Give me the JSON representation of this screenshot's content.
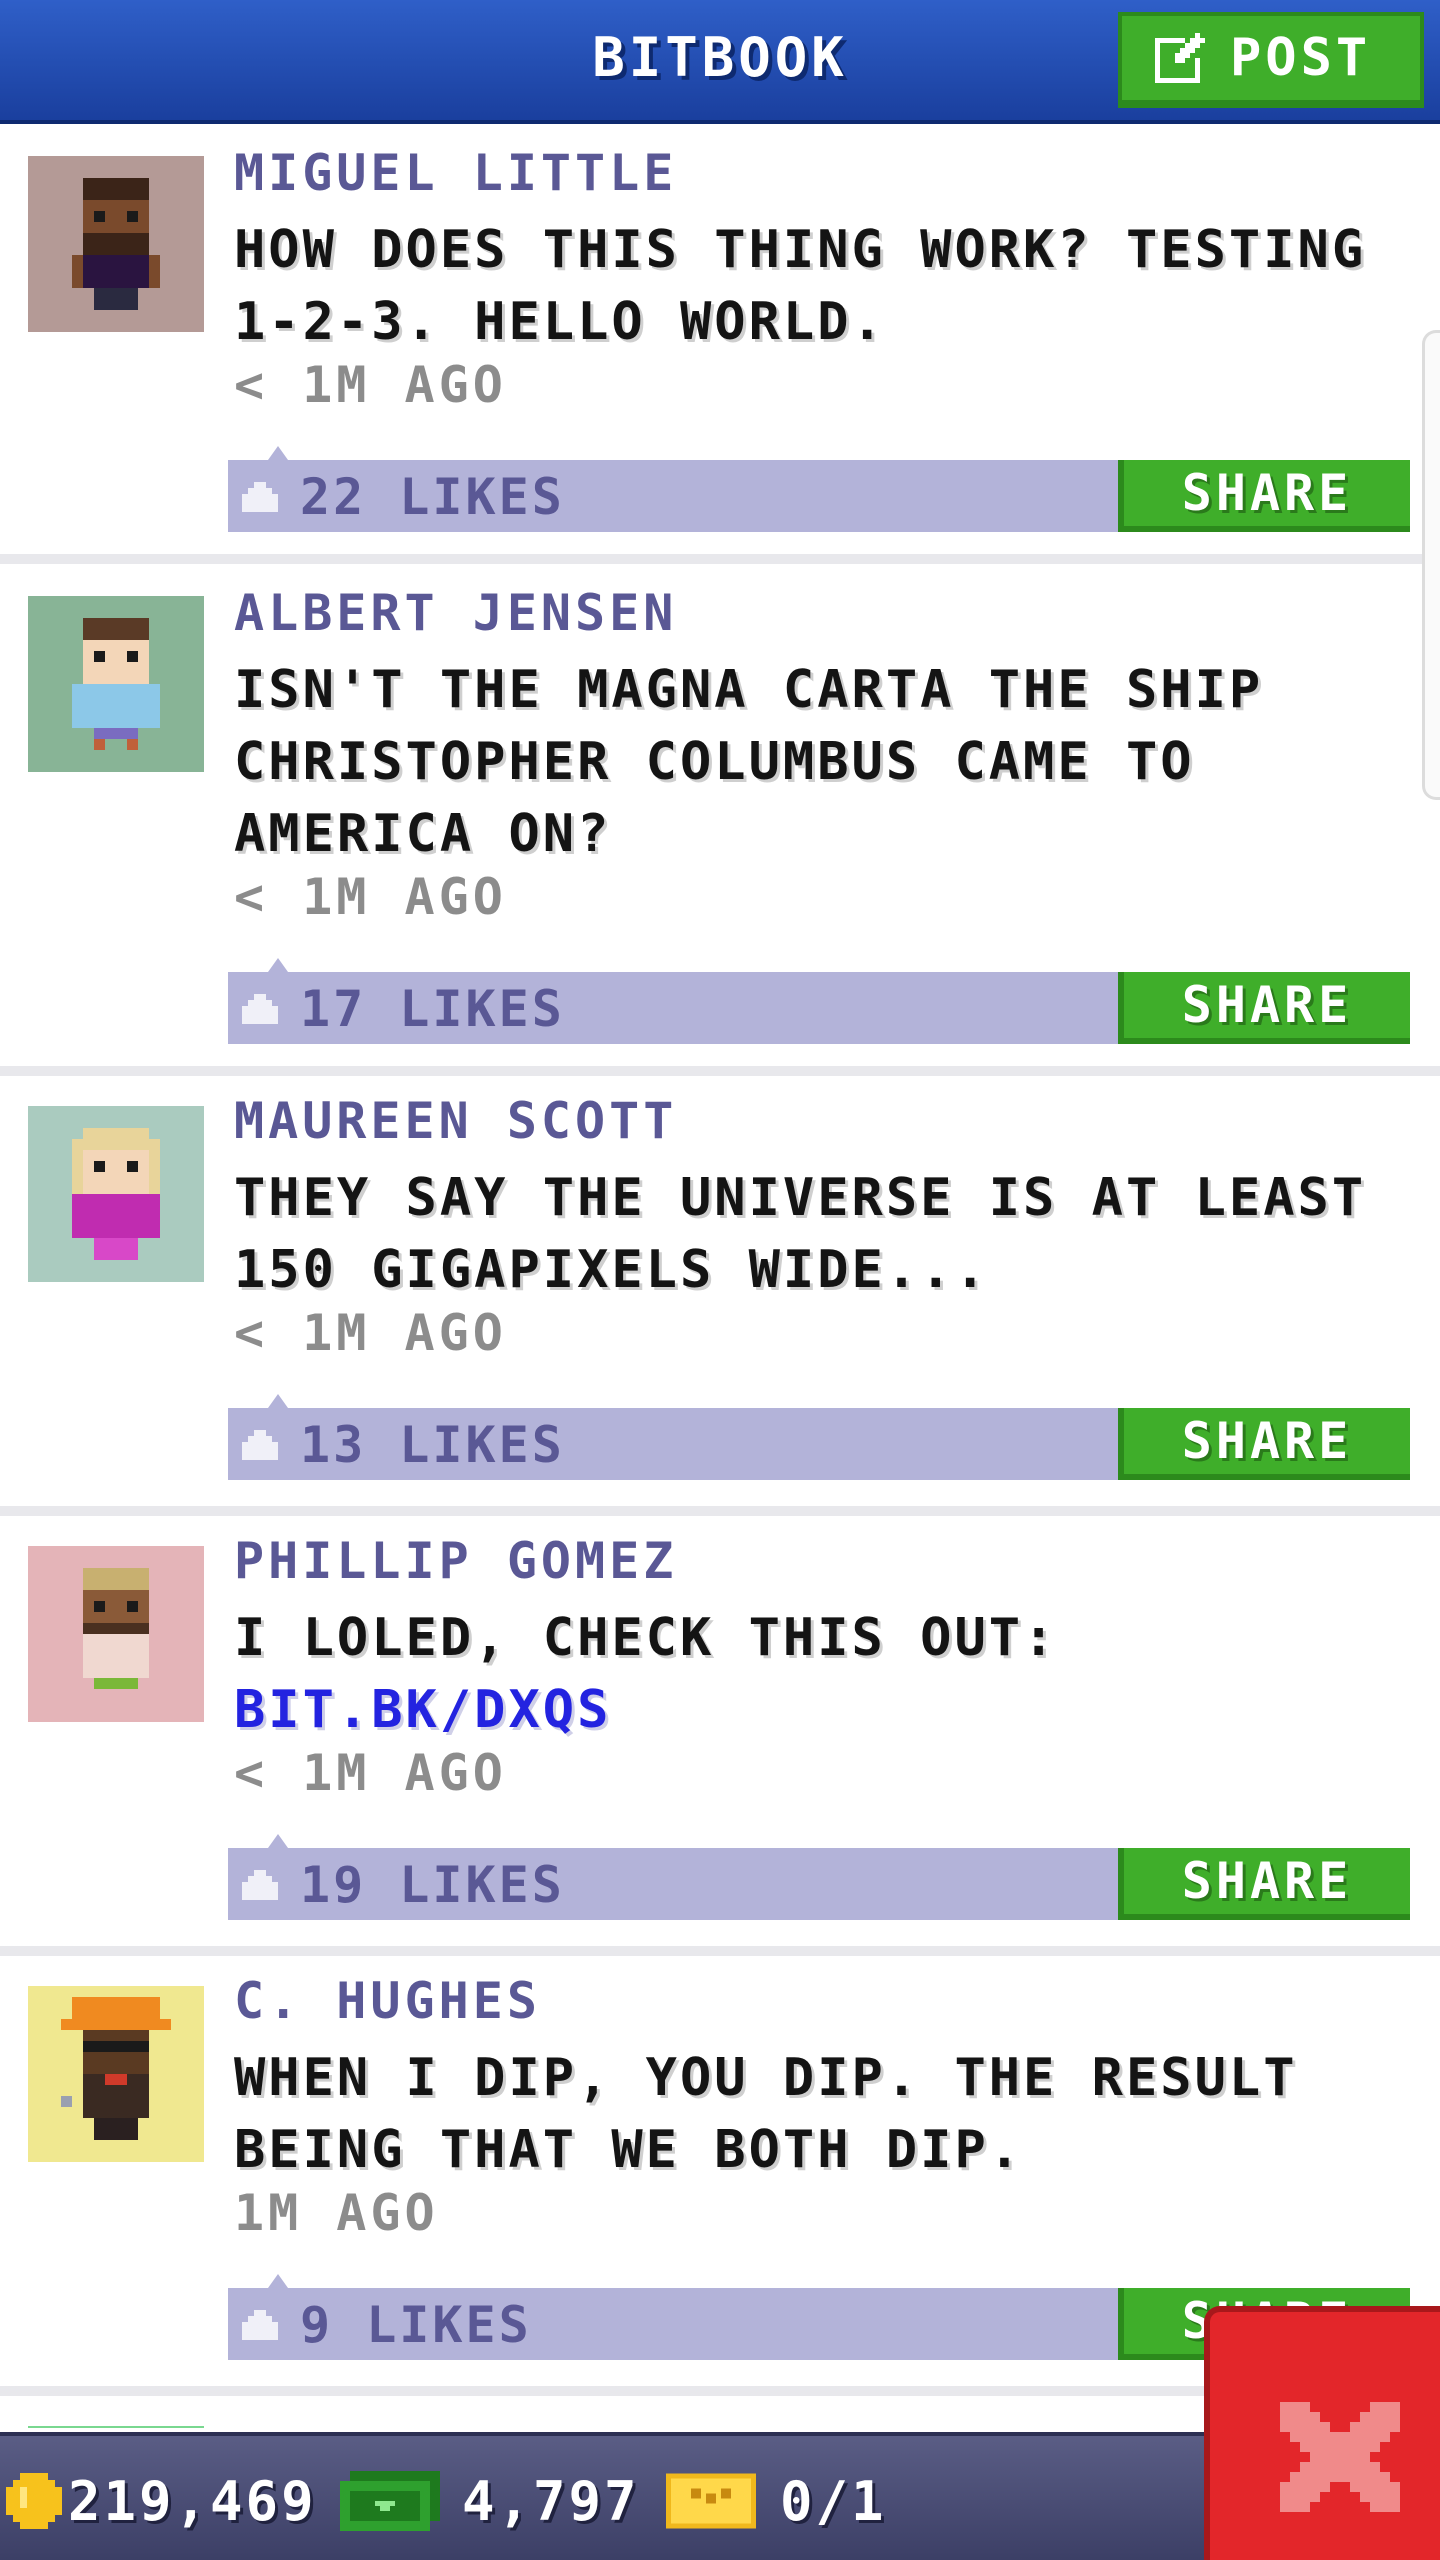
{
  "header": {
    "title": "BITBOOK",
    "post_label": "POST"
  },
  "posts": [
    {
      "author": "MIGUEL LITTLE",
      "message": "HOW DOES THIS THING WORK? TESTING 1-2-3. HELLO WORLD.",
      "timestamp": "< 1M AGO",
      "likes": "22 LIKES",
      "share": "SHARE"
    },
    {
      "author": "ALBERT JENSEN",
      "message": "ISN'T THE MAGNA CARTA THE SHIP CHRISTOPHER COLUMBUS CAME TO AMERICA ON?",
      "timestamp": "< 1M AGO",
      "likes": "17 LIKES",
      "share": "SHARE"
    },
    {
      "author": "MAUREEN SCOTT",
      "message": "THEY SAY THE UNIVERSE IS AT LEAST 150 GIGAPIXELS WIDE...",
      "timestamp": "< 1M AGO",
      "likes": "13 LIKES",
      "share": "SHARE"
    },
    {
      "author": "PHILLIP GOMEZ",
      "message": "I LOLED, CHECK THIS OUT:",
      "link": "BIT.BK/DXQS",
      "timestamp": "< 1M AGO",
      "likes": "19 LIKES",
      "share": "SHARE"
    },
    {
      "author": "C. HUGHES",
      "message": "WHEN I DIP, YOU DIP. THE RESULT BEING THAT WE BOTH DIP.",
      "timestamp": "1M AGO",
      "likes": "9 LIKES",
      "share": "SHARE"
    }
  ],
  "footer": {
    "coins": "219,469",
    "bux": "4,797",
    "tickets": "0/1"
  },
  "icons": {
    "post": "edit-icon",
    "like": "thumbs-up-icon",
    "coins": "coin-icon",
    "bux": "bux-icon",
    "tickets": "ticket-icon",
    "close": "close-icon"
  },
  "colors": {
    "header": "#2f5fc8",
    "accent_green": "#3fae2a",
    "likes_bar": "#b3b3d9",
    "author": "#5a5895",
    "link": "#2323e0",
    "close": "#e3262a",
    "footer": "#4a4d75"
  }
}
